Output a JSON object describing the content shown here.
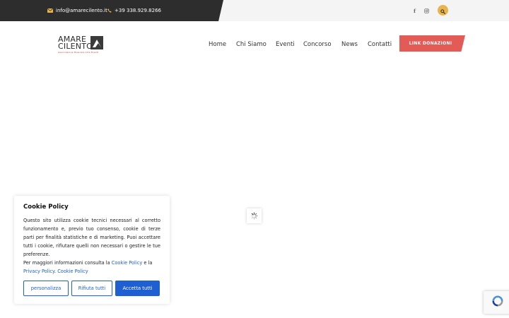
{
  "topbar": {
    "email": "info@amarecilento.it",
    "phone": "+39 338.929.8266",
    "icons": [
      "envelope-icon",
      "phone-icon",
      "facebook-icon",
      "instagram-icon",
      "search-icon"
    ],
    "accent_color": "#e9b44a",
    "dark_color": "#2d2d2d"
  },
  "logo": {
    "line1": "AMARE",
    "line2": "CILENTO",
    "subtitle": "Associazione Musicale Arte Eventi"
  },
  "nav": {
    "items": [
      "Home",
      "Chi Siamo",
      "Eventi",
      "Concorso",
      "News",
      "Contatti"
    ],
    "donate_label": "LINK DONAZIONI",
    "donate_color": "#e25b57"
  },
  "cookie": {
    "title": "Cookie Policy",
    "text": "Questo sito utilizza cookie tecnici necessari al corretto funzionamento e, previo tuo consenso, cookie di terze parti per finalità statistiche e di marketing. Puoi accettare tutti i cookie, rifiutare quelli non necessari o gestire le tue preferenze.",
    "links_prefix": "Per maggiori informazioni consulta la",
    "link_cookie": "Cookie Policy",
    "links_and": "e la",
    "link_privacy": "Privacy Policy",
    "link_cookie2": "Cookie Policy",
    "btn_customize": "personalizza",
    "btn_reject": "Rifiuta tutti",
    "btn_accept": "Accetta tutti",
    "accent_color": "#1e5fd1"
  }
}
